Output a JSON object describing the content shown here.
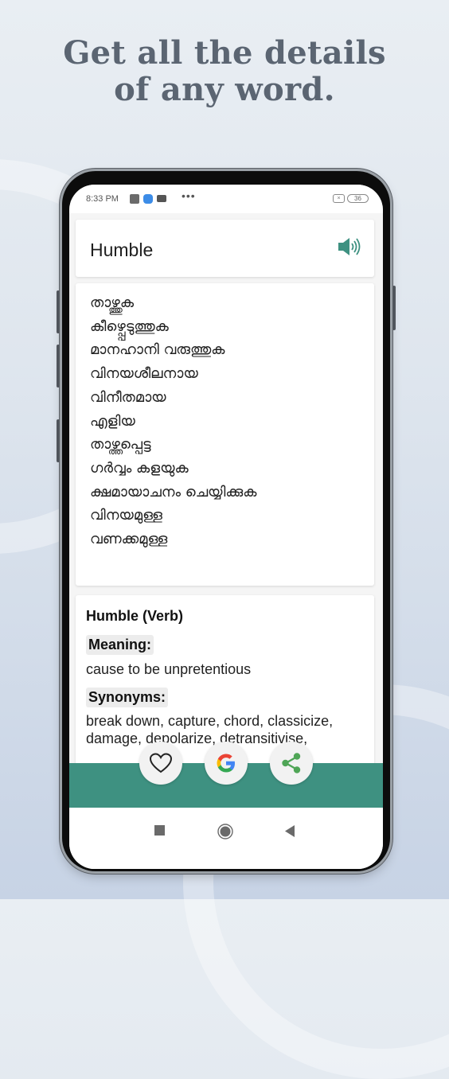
{
  "promo": {
    "headline_line1": "Get all the details",
    "headline_line2": "of any word."
  },
  "status_bar": {
    "time": "8:33 PM",
    "icons": [
      "app-notification-icon",
      "browser-notification-icon",
      "youtube-icon"
    ],
    "overflow": "•••",
    "sim_icon": "×",
    "battery": "36"
  },
  "word_card": {
    "word": "Humble",
    "speaker_icon": "speaker-icon",
    "accent_color": "#3e9181"
  },
  "malayalam_meanings": [
    "താഴ്ത്തുക",
    "കീഴ്പ്പെടുത്തുക",
    "മാനഹാനി വരുത്തുക",
    "വിനയശീലനായ",
    "വിനീതമായ",
    "എളിയ",
    "താഴ്ത്തപ്പെട്ട",
    "ഗർവ്വം കളയുക",
    "ക്ഷമായാചനം ചെയ്യിക്കുക",
    "വിനയമുള്ള",
    "വണക്കമുള്ള"
  ],
  "definition": {
    "title": "Humble (Verb)",
    "meaning_label": "Meaning:",
    "meaning": "cause to be unpretentious",
    "synonyms_label": "Synonyms:",
    "synonyms": "break down, capture, chord, classicize, damage, depolarize, detransitivise,"
  },
  "actions": {
    "favorite": "favorite-icon",
    "google": "google-search-icon",
    "share": "share-icon",
    "bar_color": "#3e9181"
  },
  "nav": {
    "recents": "recents-icon",
    "home": "home-icon",
    "back": "back-icon"
  }
}
